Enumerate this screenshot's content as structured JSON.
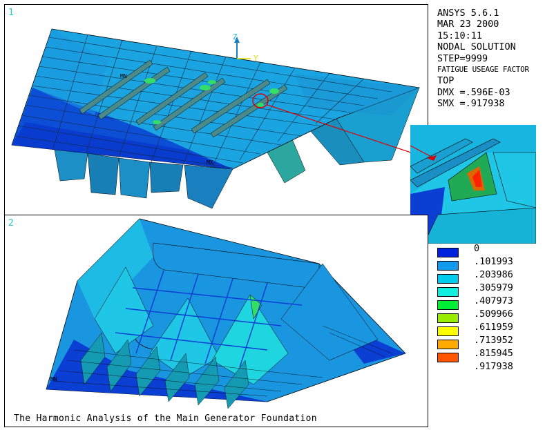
{
  "viewports": [
    {
      "number": "1",
      "markers": [
        "MN",
        "MX"
      ],
      "axis_labels": {
        "z": "Z",
        "y": "Y"
      }
    },
    {
      "number": "2",
      "markers": [
        "MN"
      ]
    }
  ],
  "info": {
    "lines": [
      "ANSYS 5.6.1",
      "MAR 23 2000",
      "15:10:11",
      "NODAL SOLUTION",
      "STEP=9999"
    ],
    "result_label": "FATIGUE USEAGE FACTOR",
    "lines2": [
      "TOP",
      "DMX =.596E-03",
      "SMX =.917938"
    ]
  },
  "legend": [
    {
      "value": "0",
      "color": "#0022dd"
    },
    {
      "value": ".101993",
      "color": "#1199ee"
    },
    {
      "value": ".203986",
      "color": "#00ccee"
    },
    {
      "value": ".305979",
      "color": "#11eedd"
    },
    {
      "value": ".407973",
      "color": "#00ee33"
    },
    {
      "value": ".509966",
      "color": "#99ee00"
    },
    {
      "value": ".611959",
      "color": "#ffff00"
    },
    {
      "value": ".713952",
      "color": "#ffaa00"
    },
    {
      "value": ".815945",
      "color": "#ff5500"
    },
    {
      "value": ".917938",
      "color": "#ff0000"
    }
  ],
  "caption": "The Harmonic Analysis of the Main Generator Foundation",
  "colors": {
    "blue": "#0b3fd4",
    "mid_blue": "#1a96e0",
    "cyan": "#1fc6e6",
    "teal": "#159ab3",
    "green": "#33cc66",
    "red_arrow": "#dd0000"
  }
}
